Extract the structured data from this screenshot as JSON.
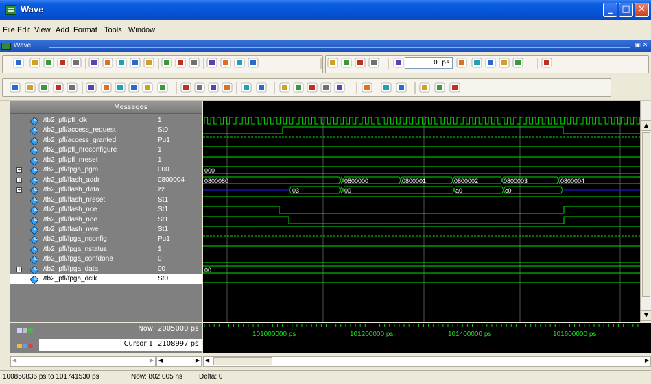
{
  "window": {
    "title": "Wave",
    "minimize": "_",
    "maximize": "□",
    "close": "✕"
  },
  "menu": [
    "File",
    "Edit",
    "View",
    "Add",
    "Format",
    "Tools",
    "Window"
  ],
  "inner_window": {
    "title": "Wave"
  },
  "toolbar": {
    "time_value": "0 ps",
    "icons_row1": [
      "new-icon",
      "open-icon",
      "save-icon",
      "reload-icon",
      "print-icon",
      "cut-icon",
      "copy-icon",
      "paste-icon",
      "undo-icon",
      "redo-icon",
      "find-icon",
      "zoom-group-icon",
      "tree-icon",
      "break-icon",
      "edit-icon",
      "run-icon",
      "stop-icon",
      "restart-icon",
      "up-arrow-icon",
      "back-arrow-icon",
      "forward-arrow-icon",
      "run-length-icon",
      "step-icon",
      "step-over-icon",
      "step-out-icon",
      "continue-icon",
      "break-over-icon",
      "hand-icon"
    ],
    "icons_row2": [
      "select-icon",
      "zoom-box-icon",
      "pan-icon",
      "text-icon",
      "cursor-icon",
      "edge-icon",
      "falling-edge-icon",
      "rising-edge-icon",
      "next-edge-icon",
      "prev-edge-icon",
      "find-edge-icon",
      "wave-add-icon",
      "wave-remove-icon",
      "wave-insert-icon",
      "wave-delete-icon",
      "insert-cursor-icon",
      "delete-cursor-icon",
      "zoom-in-icon",
      "zoom-out-icon",
      "zoom-full-icon",
      "zoom-cursor-icon",
      "zoom-region-icon",
      "format-literal-icon",
      "format-logic-icon",
      "format-analog-icon",
      "format-event-icon",
      "format-low-icon",
      "format-high-icon"
    ]
  },
  "messages_header": "Messages",
  "signals": [
    {
      "name": "/tb2_pfl/pfl_clk",
      "value": "1",
      "expandable": false
    },
    {
      "name": "/tb2_pfl/access_request",
      "value": "St0",
      "expandable": false
    },
    {
      "name": "/tb2_pfl/access_granted",
      "value": "Pu1",
      "expandable": false
    },
    {
      "name": "/tb2_pfl/pfl_nreconfigure",
      "value": "1",
      "expandable": false
    },
    {
      "name": "/tb2_pfl/pfl_nreset",
      "value": "1",
      "expandable": false
    },
    {
      "name": "/tb2_pfl/fpga_pgm",
      "value": "000",
      "expandable": true
    },
    {
      "name": "/tb2_pfl/flash_addr",
      "value": "0800004",
      "expandable": true
    },
    {
      "name": "/tb2_pfl/flash_data",
      "value": "zz",
      "expandable": true
    },
    {
      "name": "/tb2_pfl/flash_nreset",
      "value": "St1",
      "expandable": false
    },
    {
      "name": "/tb2_pfl/flash_nce",
      "value": "St1",
      "expandable": false
    },
    {
      "name": "/tb2_pfl/flash_noe",
      "value": "St1",
      "expandable": false
    },
    {
      "name": "/tb2_pfl/flash_nwe",
      "value": "St1",
      "expandable": false
    },
    {
      "name": "/tb2_pfl/fpga_nconfig",
      "value": "Pu1",
      "expandable": false
    },
    {
      "name": "/tb2_pfl/fpga_nstatus",
      "value": "1",
      "expandable": false
    },
    {
      "name": "/tb2_pfl/fpga_confdone",
      "value": "0",
      "expandable": false
    },
    {
      "name": "/tb2_pfl/fpga_data",
      "value": "00",
      "expandable": true
    },
    {
      "name": "/tb2_pfl/fpga_dclk",
      "value": "St0",
      "expandable": false,
      "selected": true
    }
  ],
  "wave_labels": {
    "fpga_pgm": "000",
    "flash_addr": [
      "0800080",
      "0800000",
      "0800001",
      "0800002",
      "0800003",
      "0800004"
    ],
    "flash_data": [
      "03",
      "00",
      "a0",
      "c0"
    ],
    "fpga_data": "00"
  },
  "now": {
    "label": "Now",
    "value": "2005000 ps"
  },
  "cursor": {
    "label": "Cursor 1",
    "value": "2108997 ps"
  },
  "timeline": [
    "101000000 ps",
    "101200000 ps",
    "101400000 ps",
    "101600000 ps"
  ],
  "status": {
    "range": "100850836 ps to 101741530 ps",
    "now": "Now: 802,005 ns",
    "delta": "Delta: 0"
  },
  "colors": {
    "wave": "#00e000",
    "background": "#000000",
    "bus_z": "#2020ff",
    "pane": "#808080"
  }
}
